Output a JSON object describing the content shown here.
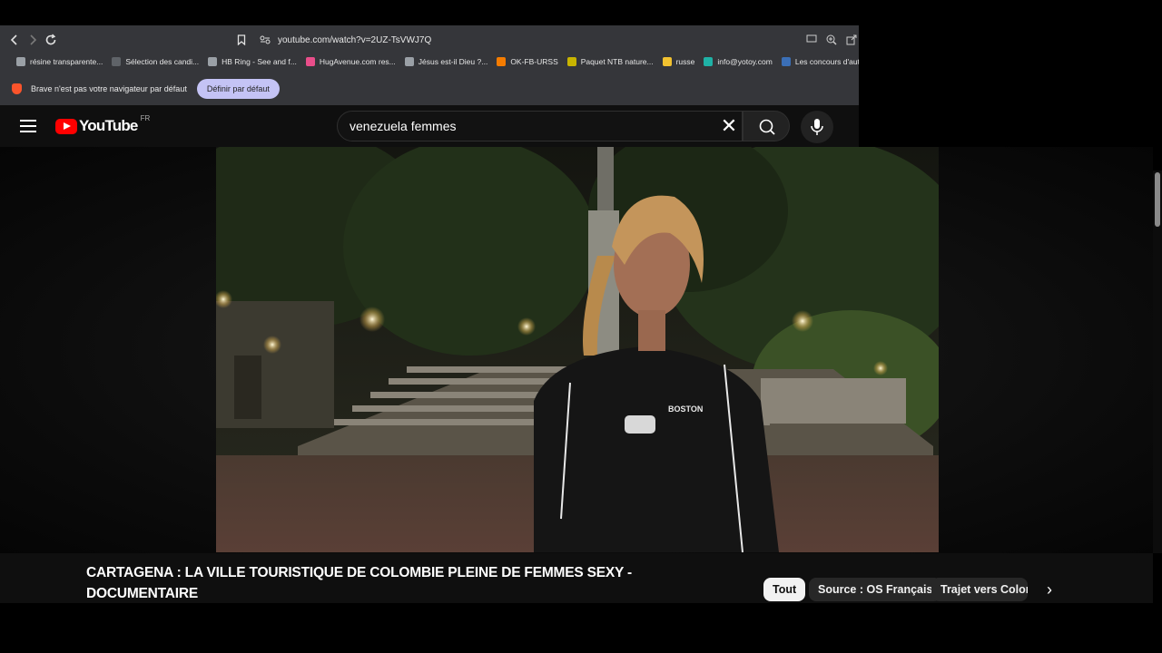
{
  "browser": {
    "url": "youtube.com/watch?v=2UZ-TsVWJ7Q",
    "bookmarks": [
      {
        "label": "résine transparente...",
        "color": "#9aa0a6"
      },
      {
        "label": "Sélection des candi...",
        "color": "#5f6368"
      },
      {
        "label": "HB Ring - See and f...",
        "color": "#9aa0a6"
      },
      {
        "label": "HugAvenue.com res...",
        "color": "#e94e8a"
      },
      {
        "label": "Jésus est-il Dieu ?...",
        "color": "#9aa0a6"
      },
      {
        "label": "OK-FB-URSS",
        "color": "#f57c00"
      },
      {
        "label": "Paquet NTB nature...",
        "color": "#c8b400"
      },
      {
        "label": "russe",
        "color": "#f2c230"
      },
      {
        "label": "info@yotoy.com",
        "color": "#1fb2a6"
      },
      {
        "label": "Les concours d'aute...",
        "color": "#3b6fb6"
      }
    ],
    "infobar": {
      "message": "Brave n'est pas votre navigateur par défaut",
      "button": "Définir par défaut"
    }
  },
  "youtube": {
    "logo_text": "YouTube",
    "region": "FR",
    "search_value": "venezuela femmes",
    "clear_symbol": "✕"
  },
  "video": {
    "title": "CARTAGENA : LA VILLE TOURISTIQUE DE COLOMBIE PLEINE DE FEMMES SEXY - DOCUMENTAIRE",
    "shirt_text": "BOSTON"
  },
  "chips": [
    "Tout",
    "Source : OS Français",
    "Trajet vers Colombie"
  ],
  "chips_next_symbol": "›"
}
